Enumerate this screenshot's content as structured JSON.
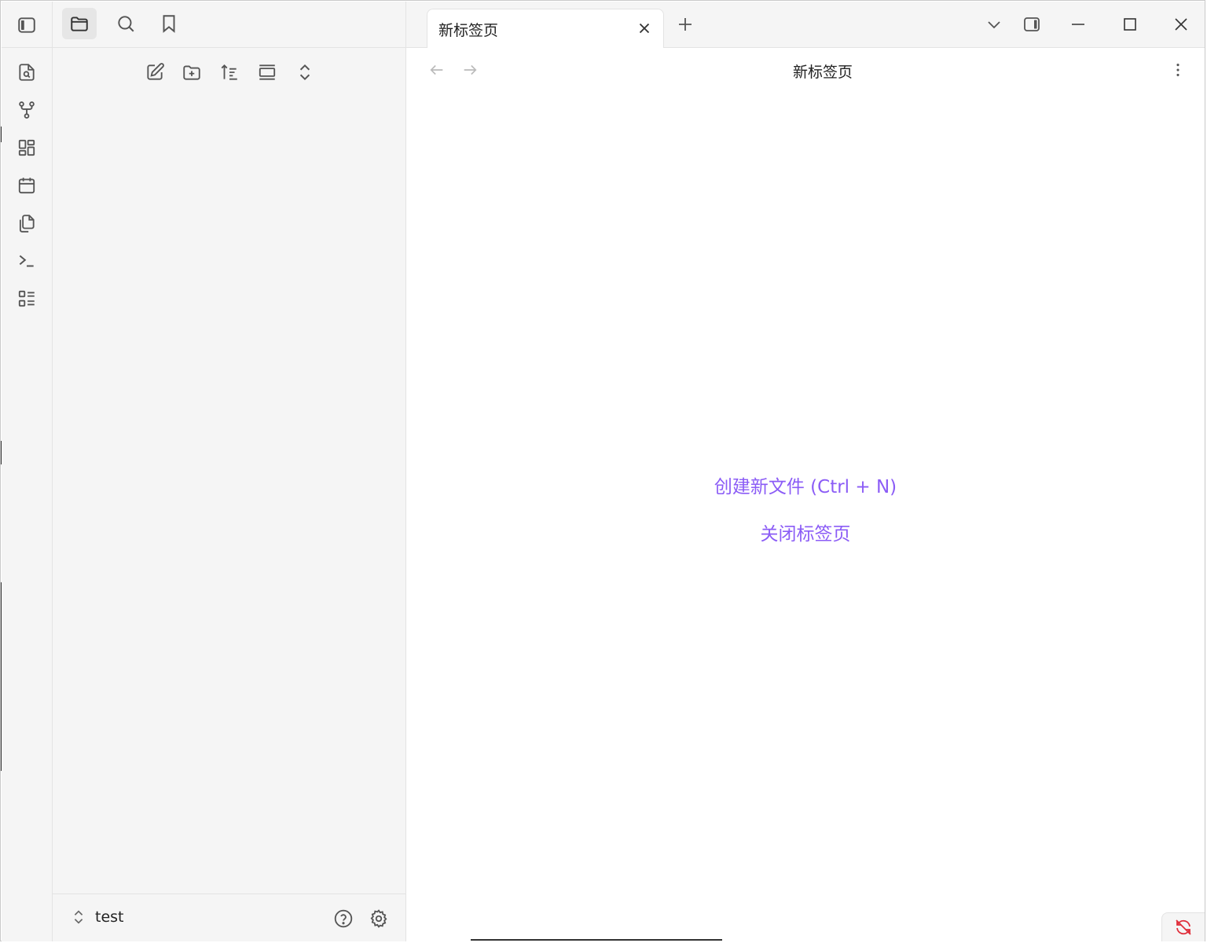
{
  "app": {
    "accent_color": "#8b5cf6",
    "icon_color": "#555555"
  },
  "ribbon": {
    "toggle_icon": "sidebar-left-icon",
    "items": [
      {
        "name": "quick-switcher",
        "icon": "file-search-icon"
      },
      {
        "name": "graph-view",
        "icon": "git-fork-icon"
      },
      {
        "name": "canvas",
        "icon": "layout-grid-icon"
      },
      {
        "name": "daily-note",
        "icon": "calendar-icon"
      },
      {
        "name": "templates",
        "icon": "copy-icon"
      },
      {
        "name": "command-palette",
        "icon": "terminal-icon"
      },
      {
        "name": "outline",
        "icon": "list-icon"
      }
    ]
  },
  "sidebar": {
    "tabs": [
      {
        "name": "files",
        "icon": "folder-icon",
        "active": true
      },
      {
        "name": "search",
        "icon": "search-icon",
        "active": false
      },
      {
        "name": "bookmarks",
        "icon": "bookmark-icon",
        "active": false
      }
    ],
    "nav_tools": [
      {
        "name": "new-note",
        "icon": "edit-icon"
      },
      {
        "name": "new-folder",
        "icon": "folder-plus-icon"
      },
      {
        "name": "sort",
        "icon": "sort-icon"
      },
      {
        "name": "auto-reveal",
        "icon": "reveal-icon"
      },
      {
        "name": "collapse-all",
        "icon": "chevrons-up-down-icon"
      }
    ],
    "footer": {
      "vault_name": "test",
      "help_icon": "help-circle-icon",
      "settings_icon": "gear-icon"
    }
  },
  "tabbar": {
    "tabs": [
      {
        "title": "新标签页",
        "active": true
      }
    ]
  },
  "view": {
    "title": "新标签页",
    "actions": {
      "create": "创建新文件 (Ctrl + N)",
      "close": "关闭标签页"
    }
  }
}
